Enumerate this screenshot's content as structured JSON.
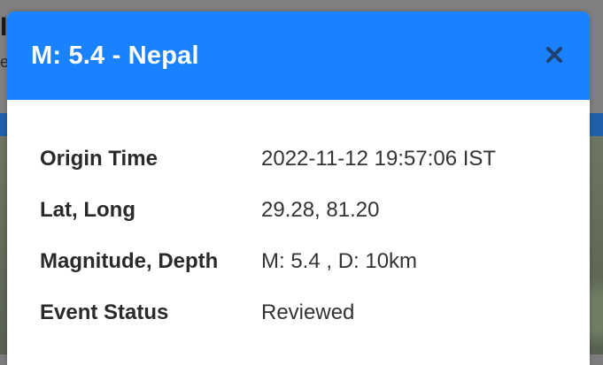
{
  "background": {
    "fragment_large": "I",
    "fragment_small": "e"
  },
  "modal": {
    "title": "M: 5.4 - Nepal",
    "close_icon": "close-icon",
    "rows": [
      {
        "label": "Origin Time",
        "value": "2022-11-12 19:57:06 IST"
      },
      {
        "label": "Lat, Long",
        "value": "29.28, 81.20"
      },
      {
        "label": "Magnitude, Depth",
        "value": "M: 5.4 , D: 10km"
      },
      {
        "label": "Event Status",
        "value": "Reviewed"
      }
    ]
  },
  "colors": {
    "header": "#1a82ff",
    "close_icon": "#1f3f6f"
  }
}
